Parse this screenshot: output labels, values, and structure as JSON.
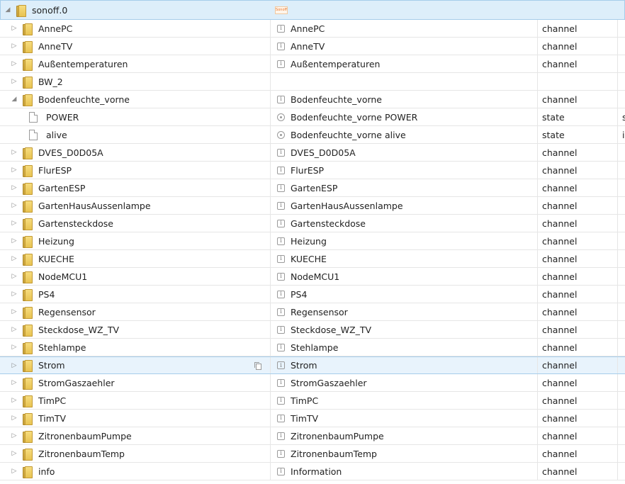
{
  "root": {
    "id": "sonoff.0",
    "logo_text": "Sonoff",
    "expanded": true
  },
  "rows": [
    {
      "id": "AnnePC",
      "name": "AnnePC",
      "type": "channel",
      "kind": "folder"
    },
    {
      "id": "AnneTV",
      "name": "AnneTV",
      "type": "channel",
      "kind": "folder"
    },
    {
      "id": "Außentemperaturen",
      "name": "Außentemperaturen",
      "type": "channel",
      "kind": "folder"
    },
    {
      "id": "BW_2",
      "name": "",
      "type": "",
      "kind": "folder"
    },
    {
      "id": "Bodenfeuchte_vorne",
      "name": "Bodenfeuchte_vorne",
      "type": "channel",
      "kind": "folder",
      "expanded": true
    },
    {
      "id": "POWER",
      "name": "Bodenfeuchte_vorne POWER",
      "type": "state",
      "role": "s",
      "kind": "state"
    },
    {
      "id": "alive",
      "name": "Bodenfeuchte_vorne alive",
      "type": "state",
      "role": "i",
      "kind": "state"
    },
    {
      "id": "DVES_D0D05A",
      "name": "DVES_D0D05A",
      "type": "channel",
      "kind": "folder"
    },
    {
      "id": "FlurESP",
      "name": "FlurESP",
      "type": "channel",
      "kind": "folder"
    },
    {
      "id": "GartenESP",
      "name": "GartenESP",
      "type": "channel",
      "kind": "folder"
    },
    {
      "id": "GartenHausAussenlampe",
      "name": "GartenHausAussenlampe",
      "type": "channel",
      "kind": "folder"
    },
    {
      "id": "Gartensteckdose",
      "name": "Gartensteckdose",
      "type": "channel",
      "kind": "folder"
    },
    {
      "id": "Heizung",
      "name": "Heizung",
      "type": "channel",
      "kind": "folder"
    },
    {
      "id": "KUECHE",
      "name": "KUECHE",
      "type": "channel",
      "kind": "folder"
    },
    {
      "id": "NodeMCU1",
      "name": "NodeMCU1",
      "type": "channel",
      "kind": "folder"
    },
    {
      "id": "PS4",
      "name": "PS4",
      "type": "channel",
      "kind": "folder"
    },
    {
      "id": "Regensensor",
      "name": "Regensensor",
      "type": "channel",
      "kind": "folder"
    },
    {
      "id": "Steckdose_WZ_TV",
      "name": "Steckdose_WZ_TV",
      "type": "channel",
      "kind": "folder"
    },
    {
      "id": "Stehlampe",
      "name": "Stehlampe",
      "type": "channel",
      "kind": "folder"
    },
    {
      "id": "Strom",
      "name": "Strom",
      "type": "channel",
      "kind": "folder",
      "selected": true
    },
    {
      "id": "StromGaszaehler",
      "name": "StromGaszaehler",
      "type": "channel",
      "kind": "folder"
    },
    {
      "id": "TimPC",
      "name": "TimPC",
      "type": "channel",
      "kind": "folder"
    },
    {
      "id": "TimTV",
      "name": "TimTV",
      "type": "channel",
      "kind": "folder"
    },
    {
      "id": "ZitronenbaumPumpe",
      "name": "ZitronenbaumPumpe",
      "type": "channel",
      "kind": "folder"
    },
    {
      "id": "ZitronenbaumTemp",
      "name": "ZitronenbaumTemp",
      "type": "channel",
      "kind": "folder"
    },
    {
      "id": "info",
      "name": "Information",
      "type": "channel",
      "kind": "folder"
    }
  ],
  "colors": {
    "selected_bg": "#e8f3fc",
    "root_bg": "#ddeefa",
    "folder": "#e8c351"
  }
}
